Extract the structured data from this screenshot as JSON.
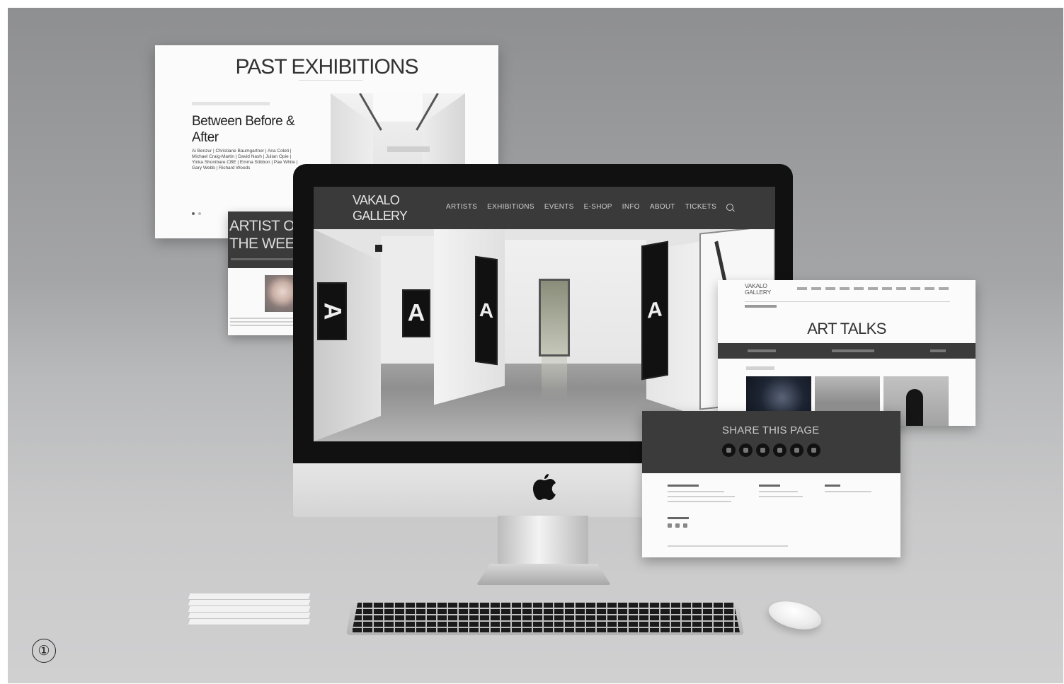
{
  "step_marker": "①",
  "past_exhibitions": {
    "heading": "PAST EXHIBITIONS",
    "exhibition_title": "Between Before & After",
    "artists": "Ai Benzur | Christiane Baumgartner | Ana Coleti | Michael Craig-Martin | David Nash | Julian Opie | Yinka Shonibare CBE | Emma Stibbon | Pae White | Gary Webb | Richard Woods"
  },
  "artist_of_week": {
    "heading": "ARTIST OF THE WEEK"
  },
  "site": {
    "logo": "VAKALO GALLERY",
    "menu": [
      "ARTISTS",
      "EXHIBITIONS",
      "EVENTS",
      "E-SHOP",
      "INFO",
      "ABOUT",
      "TICKETS"
    ],
    "search_icon": "search-icon"
  },
  "art_talks": {
    "logo": "VAKALO GALLERY",
    "heading": "ART TALKS"
  },
  "share": {
    "heading": "SHARE THIS PAGE",
    "icons": [
      "twitter-icon",
      "facebook-icon",
      "pinterest-icon",
      "tumblr-icon",
      "email-icon",
      "more-icon"
    ]
  },
  "colors": {
    "backdrop": "#a4a5a7",
    "nav_dark": "#3a3a3a",
    "card_white": "#fbfbfb"
  }
}
